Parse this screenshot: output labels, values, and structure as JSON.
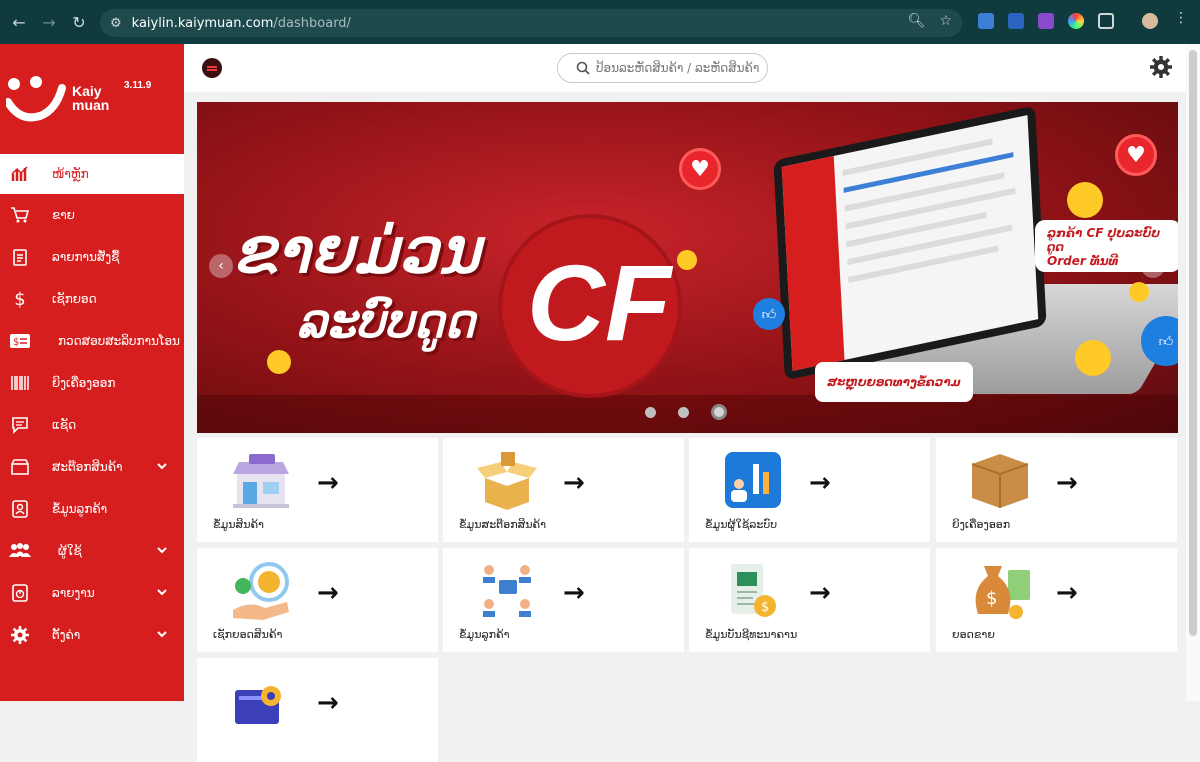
{
  "browser": {
    "url_host": "kaiylin.kaiymuan.com",
    "url_path": "/dashboard/"
  },
  "brand": {
    "name_line1": "Kaiy",
    "name_line2": "muan",
    "version": "3.11.9",
    "primary_color": "#d71e1e"
  },
  "sidebar": {
    "items": [
      {
        "label": "ໜ້າຫຼັກ",
        "icon": "chart-icon",
        "active": true
      },
      {
        "label": "ຂາຍ",
        "icon": "cart-icon"
      },
      {
        "label": "ລາຍການສັ່ງຊື້",
        "icon": "clipboard-icon"
      },
      {
        "label": "ເຊັກຍອດ",
        "icon": "dollar-icon"
      },
      {
        "label": "ກວດສອບສະລິບການໂອນ",
        "icon": "payment-card-icon"
      },
      {
        "label": "ຍິງເຄື່ອງອອກ",
        "icon": "barcode-icon"
      },
      {
        "label": "ແຊັດ",
        "icon": "chat-icon"
      },
      {
        "label": "ສະຕ໊ອກສິນຄ້າ",
        "icon": "store-icon",
        "caret": true
      },
      {
        "label": "ຂໍ້ມູນລູກຄ້າ",
        "icon": "contact-icon"
      },
      {
        "label": "ຜູ້ໃຊ້",
        "icon": "users-icon",
        "caret": true
      },
      {
        "label": "ລາຍງານ",
        "icon": "report-icon",
        "caret": true
      },
      {
        "label": "ຕັ້ງຄ່າ",
        "icon": "gear-icon",
        "caret": true
      }
    ]
  },
  "search": {
    "placeholder": "ປ້ອນລະຫັດສິນຄ້າ / ລະຫັດສິນຄ້າ"
  },
  "banner": {
    "headline": "ຂາຍມ່ວນ",
    "subline": "ລະບົບດູດ",
    "cf": "CF",
    "callout_top_line1": "ລູກຄ້າ CF ປຸບລະບົບດູດ",
    "callout_top_line2": "Order ທັນທີ",
    "callout_bottom": "ສະຫຼຸບຍອດທາງຂໍ້ຄວາມ",
    "slides": 3,
    "active_slide": 3
  },
  "cards": [
    {
      "label": "ຂໍ້ມູນສິນຄ້າ",
      "art": "store-illustration"
    },
    {
      "label": "ຂໍ້ມູນສະຕ໊ອກສິນຄ້າ",
      "art": "open-box-illustration"
    },
    {
      "label": "ຂໍ້ມູນຜູ້ໃຊ້ລະບົບ",
      "art": "bar-chart-illustration"
    },
    {
      "label": "ຍິງເຄື່ອງອອກ",
      "art": "closed-box-illustration"
    },
    {
      "label": "ເຊັກຍອດສິນຄ້າ",
      "art": "hand-coin-illustration"
    },
    {
      "label": "ຂໍ້ມູນລູກຄ້າ",
      "art": "people-network-illustration"
    },
    {
      "label": "ຂໍ້ມູນບັນຊີທະນາຄານ",
      "art": "bank-document-illustration"
    },
    {
      "label": "ຍອດຂາຍ",
      "art": "money-bag-illustration"
    },
    {
      "label": "",
      "art": "gear-window-illustration"
    }
  ],
  "arrow_glyph": "→"
}
